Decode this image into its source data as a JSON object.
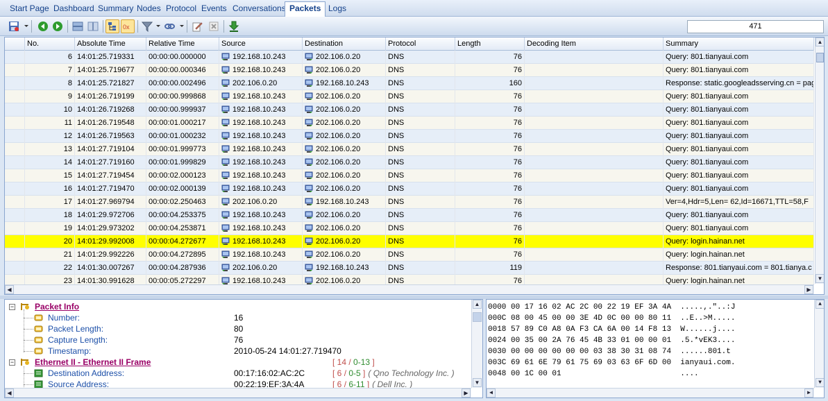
{
  "tabs": [
    {
      "label": "Start Page",
      "active": false
    },
    {
      "label": "Dashboard",
      "active": false
    },
    {
      "label": "Summary",
      "active": false
    },
    {
      "label": "Nodes",
      "active": false
    },
    {
      "label": "Protocol",
      "active": false
    },
    {
      "label": "Events",
      "active": false
    },
    {
      "label": "Conversations",
      "active": false
    },
    {
      "label": "Packets",
      "active": true
    },
    {
      "label": "Logs",
      "active": false
    }
  ],
  "toolbar": {
    "icons": [
      "save-icon",
      "back-icon",
      "forward-icon",
      "layout-icon",
      "columns-icon",
      "tree-view-icon",
      "hex-view-icon",
      "filter-icon",
      "link-icon",
      "edit-icon",
      "delete-icon",
      "download-icon"
    ],
    "packet_count": "471"
  },
  "packets": {
    "columns": [
      "No.",
      "Absolute Time",
      "Relative Time",
      "Source",
      "Destination",
      "Protocol",
      "Length",
      "Decoding Item",
      "Summary"
    ],
    "rows": [
      {
        "no": "6",
        "abs": "14:01:25.719331",
        "rel": "00:00:00.000000",
        "src": "192.168.10.243",
        "dst": "202.106.0.20",
        "proto": "DNS",
        "len": "76",
        "dec": "",
        "summary": "Query: 801.tianyaui.com",
        "highlight": false
      },
      {
        "no": "7",
        "abs": "14:01:25.719677",
        "rel": "00:00:00.000346",
        "src": "192.168.10.243",
        "dst": "202.106.0.20",
        "proto": "DNS",
        "len": "76",
        "dec": "",
        "summary": "Query: 801.tianyaui.com",
        "highlight": false
      },
      {
        "no": "8",
        "abs": "14:01:25.721827",
        "rel": "00:00:00.002496",
        "src": "202.106.0.20",
        "dst": "192.168.10.243",
        "proto": "DNS",
        "len": "160",
        "dec": "",
        "summary": "Response: static.googleadsserving.cn = pag",
        "highlight": false
      },
      {
        "no": "9",
        "abs": "14:01:26.719199",
        "rel": "00:00:00.999868",
        "src": "192.168.10.243",
        "dst": "202.106.0.20",
        "proto": "DNS",
        "len": "76",
        "dec": "",
        "summary": "Query: 801.tianyaui.com",
        "highlight": false
      },
      {
        "no": "10",
        "abs": "14:01:26.719268",
        "rel": "00:00:00.999937",
        "src": "192.168.10.243",
        "dst": "202.106.0.20",
        "proto": "DNS",
        "len": "76",
        "dec": "",
        "summary": "Query: 801.tianyaui.com",
        "highlight": false
      },
      {
        "no": "11",
        "abs": "14:01:26.719548",
        "rel": "00:00:01.000217",
        "src": "192.168.10.243",
        "dst": "202.106.0.20",
        "proto": "DNS",
        "len": "76",
        "dec": "",
        "summary": "Query: 801.tianyaui.com",
        "highlight": false
      },
      {
        "no": "12",
        "abs": "14:01:26.719563",
        "rel": "00:00:01.000232",
        "src": "192.168.10.243",
        "dst": "202.106.0.20",
        "proto": "DNS",
        "len": "76",
        "dec": "",
        "summary": "Query: 801.tianyaui.com",
        "highlight": false
      },
      {
        "no": "13",
        "abs": "14:01:27.719104",
        "rel": "00:00:01.999773",
        "src": "192.168.10.243",
        "dst": "202.106.0.20",
        "proto": "DNS",
        "len": "76",
        "dec": "",
        "summary": "Query: 801.tianyaui.com",
        "highlight": false
      },
      {
        "no": "14",
        "abs": "14:01:27.719160",
        "rel": "00:00:01.999829",
        "src": "192.168.10.243",
        "dst": "202.106.0.20",
        "proto": "DNS",
        "len": "76",
        "dec": "",
        "summary": "Query: 801.tianyaui.com",
        "highlight": false
      },
      {
        "no": "15",
        "abs": "14:01:27.719454",
        "rel": "00:00:02.000123",
        "src": "192.168.10.243",
        "dst": "202.106.0.20",
        "proto": "DNS",
        "len": "76",
        "dec": "",
        "summary": "Query: 801.tianyaui.com",
        "highlight": false
      },
      {
        "no": "16",
        "abs": "14:01:27.719470",
        "rel": "00:00:02.000139",
        "src": "192.168.10.243",
        "dst": "202.106.0.20",
        "proto": "DNS",
        "len": "76",
        "dec": "",
        "summary": "Query: 801.tianyaui.com",
        "highlight": false
      },
      {
        "no": "17",
        "abs": "14:01:27.969794",
        "rel": "00:00:02.250463",
        "src": "202.106.0.20",
        "dst": "192.168.10.243",
        "proto": "DNS",
        "len": "76",
        "dec": "",
        "summary": "Ver=4,Hdr=5,Len=  62,Id=16671,TTL=58,F",
        "highlight": false
      },
      {
        "no": "18",
        "abs": "14:01:29.972706",
        "rel": "00:00:04.253375",
        "src": "192.168.10.243",
        "dst": "202.106.0.20",
        "proto": "DNS",
        "len": "76",
        "dec": "",
        "summary": "Query: 801.tianyaui.com",
        "highlight": false
      },
      {
        "no": "19",
        "abs": "14:01:29.973202",
        "rel": "00:00:04.253871",
        "src": "192.168.10.243",
        "dst": "202.106.0.20",
        "proto": "DNS",
        "len": "76",
        "dec": "",
        "summary": "Query: 801.tianyaui.com",
        "highlight": false
      },
      {
        "no": "20",
        "abs": "14:01:29.992008",
        "rel": "00:00:04.272677",
        "src": "192.168.10.243",
        "dst": "202.106.0.20",
        "proto": "DNS",
        "len": "76",
        "dec": "",
        "summary": "Query: login.hainan.net",
        "highlight": true
      },
      {
        "no": "21",
        "abs": "14:01:29.992226",
        "rel": "00:00:04.272895",
        "src": "192.168.10.243",
        "dst": "202.106.0.20",
        "proto": "DNS",
        "len": "76",
        "dec": "",
        "summary": "Query: login.hainan.net",
        "highlight": false
      },
      {
        "no": "22",
        "abs": "14:01:30.007267",
        "rel": "00:00:04.287936",
        "src": "202.106.0.20",
        "dst": "192.168.10.243",
        "proto": "DNS",
        "len": "119",
        "dec": "",
        "summary": "Response: 801.tianyaui.com = 801.tianya.c",
        "highlight": false
      },
      {
        "no": "23",
        "abs": "14:01:30.991628",
        "rel": "00:00:05.272297",
        "src": "192.168.10.243",
        "dst": "202.106.0.20",
        "proto": "DNS",
        "len": "76",
        "dec": "",
        "summary": "Query: login.hainan.net",
        "highlight": false
      }
    ]
  },
  "decode_tree": {
    "packet_info": {
      "label": "Packet Info",
      "fields": [
        {
          "name": "Number:",
          "value": "16"
        },
        {
          "name": "Packet Length:",
          "value": "80"
        },
        {
          "name": "Capture Length:",
          "value": "76"
        },
        {
          "name": "Timestamp:",
          "value": "2010-05-24 14:01:27.719470"
        }
      ]
    },
    "ethernet": {
      "label": "Ethernet II - Ethernet II Frame",
      "range_a": "14",
      "range_b": "0-13",
      "fields": [
        {
          "name": "Destination Address:",
          "value": "00:17:16:02:AC:2C",
          "ra": "6",
          "rb": "0-5",
          "comment": "( Qno Technology Inc. )"
        },
        {
          "name": "Source Address:",
          "value": "00:22:19:EF:3A:4A",
          "ra": "6",
          "rb": "6-11",
          "comment": "( Dell Inc. )"
        }
      ]
    }
  },
  "hex_dump": [
    "0000 00 17 16 02 AC 2C 00 22 19 EF 3A 4A  .....,.\"..:J",
    "000C 08 00 45 00 00 3E 4D 0C 00 00 80 11  ..E..>M.....",
    "0018 57 89 C0 A8 0A F3 CA 6A 00 14 F8 13  W......j....",
    "0024 00 35 00 2A 76 45 4B 33 01 00 00 01  .5.*vEK3....",
    "0030 00 00 00 00 00 00 03 38 30 31 08 74  ......801.t",
    "003C 69 61 6E 79 61 75 69 03 63 6F 6D 00  ianyaui.com.",
    "0048 00 1C 00 01                          ...."
  ]
}
